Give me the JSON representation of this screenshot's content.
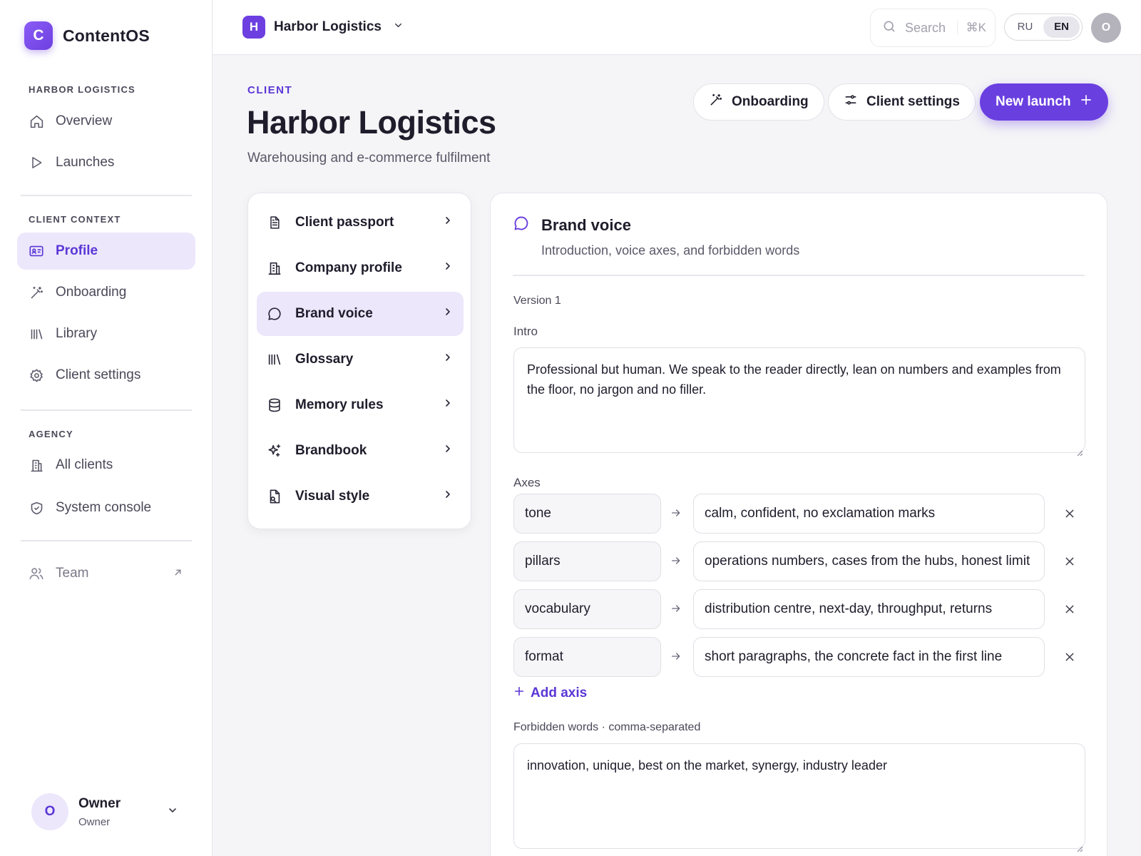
{
  "brand": {
    "logo_letter": "C",
    "name": "ContentOS"
  },
  "sidebar": {
    "section_client": "HARBOR LOGISTICS",
    "section_context": "CLIENT CONTEXT",
    "section_agency": "AGENCY",
    "items": [
      {
        "label": "Overview",
        "icon": "home-icon"
      },
      {
        "label": "Launches",
        "icon": "play-icon"
      },
      {
        "label": "Profile",
        "icon": "id-card-icon",
        "active": true
      },
      {
        "label": "Onboarding",
        "icon": "magic-wand-icon"
      },
      {
        "label": "Library",
        "icon": "library-icon"
      },
      {
        "label": "Client settings",
        "icon": "gear-icon"
      },
      {
        "label": "All clients",
        "icon": "building-icon"
      },
      {
        "label": "System console",
        "icon": "shield-icon"
      },
      {
        "label": "Team",
        "icon": "users-icon"
      }
    ],
    "owner": {
      "initial": "O",
      "name": "Owner",
      "role": "Owner"
    }
  },
  "topbar": {
    "workspace_letter": "H",
    "workspace_name": "Harbor Logistics",
    "search_placeholder": "Search",
    "search_shortcut": "⌘K",
    "lang_ru": "RU",
    "lang_en": "EN",
    "lang_selected": "EN",
    "avatar_initial": "O"
  },
  "header": {
    "eyebrow": "CLIENT",
    "title": "Harbor Logistics",
    "subtitle": "Warehousing and e-commerce fulfilment",
    "onboarding_label": "Onboarding",
    "client_settings_label": "Client settings",
    "new_launch_label": "New launch"
  },
  "sections": [
    {
      "label": "Client passport",
      "icon": "document-icon"
    },
    {
      "label": "Company profile",
      "icon": "building-icon"
    },
    {
      "label": "Brand voice",
      "icon": "chat-bubble-icon",
      "active": true
    },
    {
      "label": "Glossary",
      "icon": "library-icon"
    },
    {
      "label": "Memory rules",
      "icon": "database-icon"
    },
    {
      "label": "Brandbook",
      "icon": "sparkles-icon"
    },
    {
      "label": "Visual style",
      "icon": "file-image-icon"
    }
  ],
  "brand_voice": {
    "title": "Brand voice",
    "subtitle": "Introduction, voice axes, and forbidden words",
    "version": "Version 1",
    "intro_label": "Intro",
    "intro_text": "Professional but human. We speak to the reader directly, lean on numbers and examples from the floor, no jargon and no filler.",
    "axes_label": "Axes",
    "axes": [
      {
        "key": "tone",
        "value": "calm, confident, no exclamation marks"
      },
      {
        "key": "pillars",
        "value": "operations numbers, cases from the hubs, honest limit"
      },
      {
        "key": "vocabulary",
        "value": "distribution centre, next-day, throughput, returns"
      },
      {
        "key": "format",
        "value": "short paragraphs, the concrete fact in the first line"
      }
    ],
    "add_axis_label": "Add axis",
    "forbidden_label": "Forbidden words · comma-separated",
    "forbidden_text": "innovation, unique, best on the market, synergy, industry leader"
  },
  "colors": {
    "accent": "#6a3fe0",
    "accent_soft": "#ece7fb",
    "text": "#1f1d2b",
    "muted": "#5a5868"
  }
}
